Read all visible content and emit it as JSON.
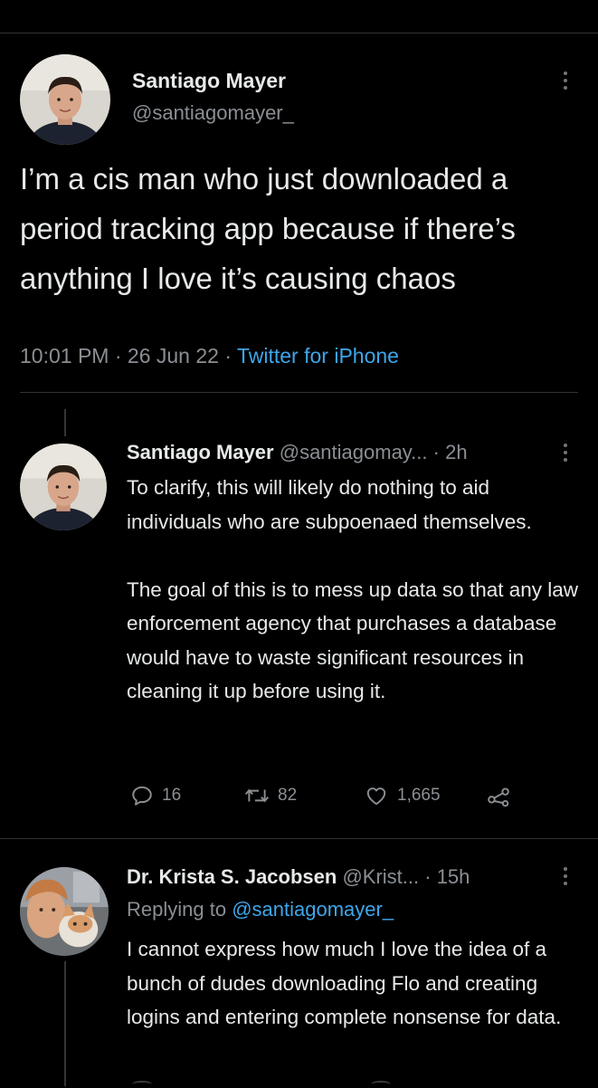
{
  "main_tweet": {
    "display_name": "Santiago Mayer",
    "handle": "@santiagomayer_",
    "text": "I’m a cis man who just downloaded a period tracking app because if there’s anything I love it’s causing chaos",
    "time": "10:01 PM",
    "date": "26 Jun 22",
    "separator": "·",
    "source": "Twitter for iPhone"
  },
  "reply1": {
    "display_name": "Santiago Mayer",
    "handle": "@santiagomay...",
    "time_ago": "· 2h",
    "paragraph1": "To clarify, this will likely do nothing to aid individuals who are subpoenaed themselves.",
    "paragraph2": "The goal of this is to mess up data so that any law enforcement agency that purchases a database would have to waste significant resources in cleaning it up before using it.",
    "replies": "16",
    "retweets": "82",
    "likes": "1,665"
  },
  "reply2": {
    "display_name": "Dr. Krista S. Jacobsen",
    "handle": "@Krist...",
    "time_ago": "· 15h",
    "replying_prefix": "Replying to ",
    "replying_to": "@santiagomayer_",
    "text": "I cannot express how much I love the idea of a bunch of dudes downloading Flo and creating logins and entering complete nonsense for data."
  },
  "icons": {
    "more": "more-vertical-icon",
    "reply": "reply-icon",
    "retweet": "retweet-icon",
    "like": "heart-icon",
    "share": "share-icon"
  },
  "colors": {
    "background": "#000000",
    "text": "#e7e9ea",
    "muted": "#8b8f94",
    "link": "#3fa6ea",
    "divider": "#2f3336"
  }
}
